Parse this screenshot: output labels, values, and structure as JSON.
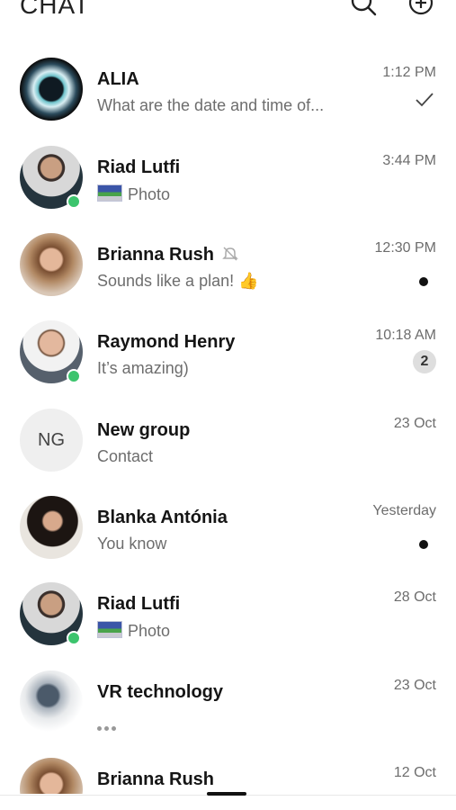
{
  "header": {
    "title": "CHAT"
  },
  "chats": [
    {
      "name": "ALIA",
      "message": "What are the date and time of...",
      "time": "1:12 PM",
      "status": "read-check",
      "avatar": "alia-orb-icon"
    },
    {
      "name": "Riad Lutfi",
      "message": "Photo",
      "time": "3:44 PM",
      "online": true,
      "attachment": "photo-icon"
    },
    {
      "name": "Brianna Rush",
      "message": "Sounds like a plan! 👍",
      "time": "12:30 PM",
      "muted": true,
      "status": "unread-dot"
    },
    {
      "name": "Raymond Henry",
      "message": "It’s amazing)",
      "time": "10:18 AM",
      "online": true,
      "unread_count": "2"
    },
    {
      "name": "New group",
      "message": "Contact",
      "time": "23 Oct",
      "initials": "NG"
    },
    {
      "name": "Blanka Antónia",
      "message": "You know",
      "time": "Yesterday",
      "status": "unread-dot"
    },
    {
      "name": "Riad Lutfi",
      "message": "Photo",
      "time": "28 Oct",
      "online": true,
      "attachment": "photo-icon"
    },
    {
      "name": "VR technology",
      "message": "",
      "time": "23 Oct",
      "typing": true
    },
    {
      "name": "Brianna Rush",
      "message": "",
      "time": "12 Oct"
    }
  ],
  "colors": {
    "online": "#3cc46d",
    "muted_text": "#6d6d6d",
    "badge_bg": "#dedede"
  }
}
